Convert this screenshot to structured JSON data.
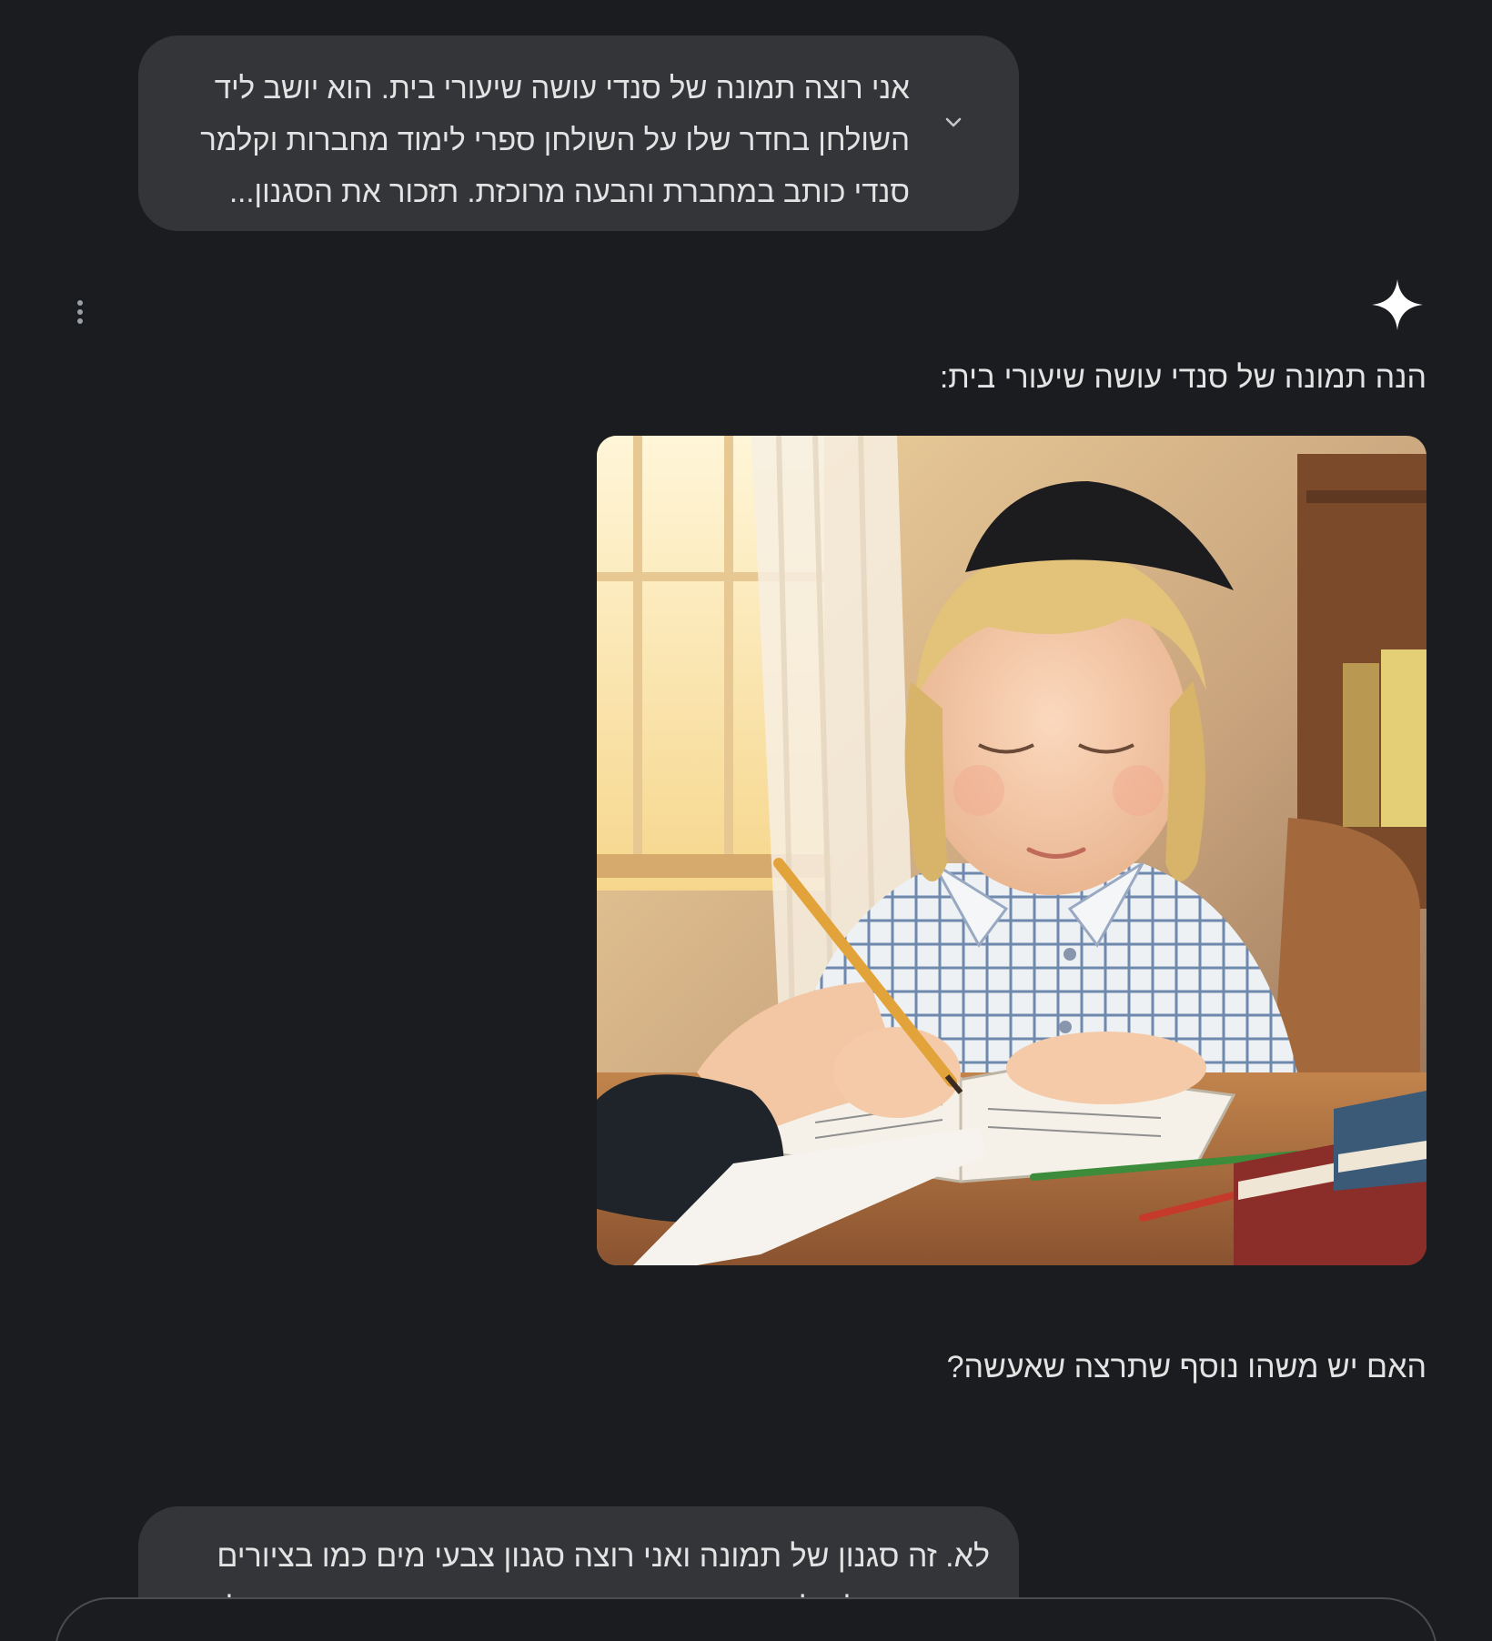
{
  "conversation": {
    "user_message_1": {
      "lines": [
        "אני רוצה תמונה של סנדי עושה שיעורי בית. הוא יושב ליד",
        "השולחן בחדר שלו על השולחן ספרי לימוד מחברות וקלמר",
        "סנדי כותב במחברת והבעה מרוכזת. תזכור את הסגנון..."
      ],
      "expand_icon": "chevron-down-icon"
    },
    "assistant": {
      "icon": "sparkle-icon",
      "menu_icon": "more-vert-icon",
      "intro": "הנה תמונה של סנדי עושה שיעורי בית:",
      "followup": "האם יש משהו נוסף שתרצה שאעשה?"
    },
    "user_message_2": {
      "lines": [
        "לא. זה סגנון של תמונה ואני רוצה סגנון צבעי מים כמו בציורים",
        "הקודמים. לא לשנות ההבעה ועוד הקודת הששאה השש עד לבו"
      ]
    }
  },
  "colors": {
    "background": "#1b1c1f",
    "bubble": "#333539",
    "text": "#e3e3e3",
    "muted_icon": "#9aa0a6"
  }
}
